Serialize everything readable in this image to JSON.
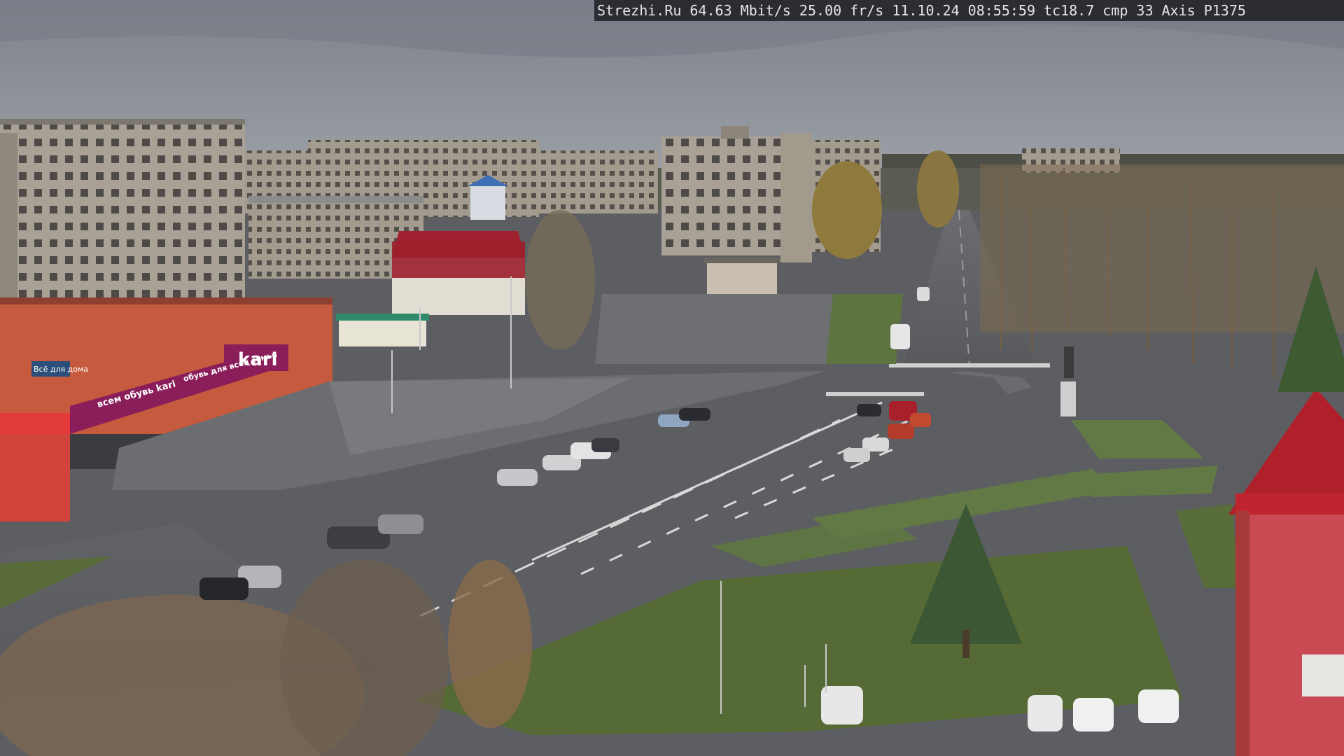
{
  "camera_overlay": {
    "site": "Strezhi.Ru",
    "bitrate": "64.63 Mbit/s",
    "framerate": "25.00 fr/s",
    "date": "11.10.24",
    "time": "08:55:59",
    "tc": "tc18.7",
    "cmp": "cmp 33",
    "camera_model": "Axis P1375"
  },
  "storefront_signs": {
    "brand": "kari",
    "upper_slogan": "обувь для всей семьи",
    "lower_slogan": "всем обувь kari",
    "small_sign": "Всё для дома"
  },
  "colors": {
    "sky": "#868b93",
    "asphalt": "#5f6167",
    "grass": "#556a35",
    "store_facade": "#c65a3e",
    "store_sign": "#8a1e5a",
    "red_roof": "#b0202a",
    "panel_building": "#a9a094",
    "overlay_bg": "#2b2d33"
  }
}
